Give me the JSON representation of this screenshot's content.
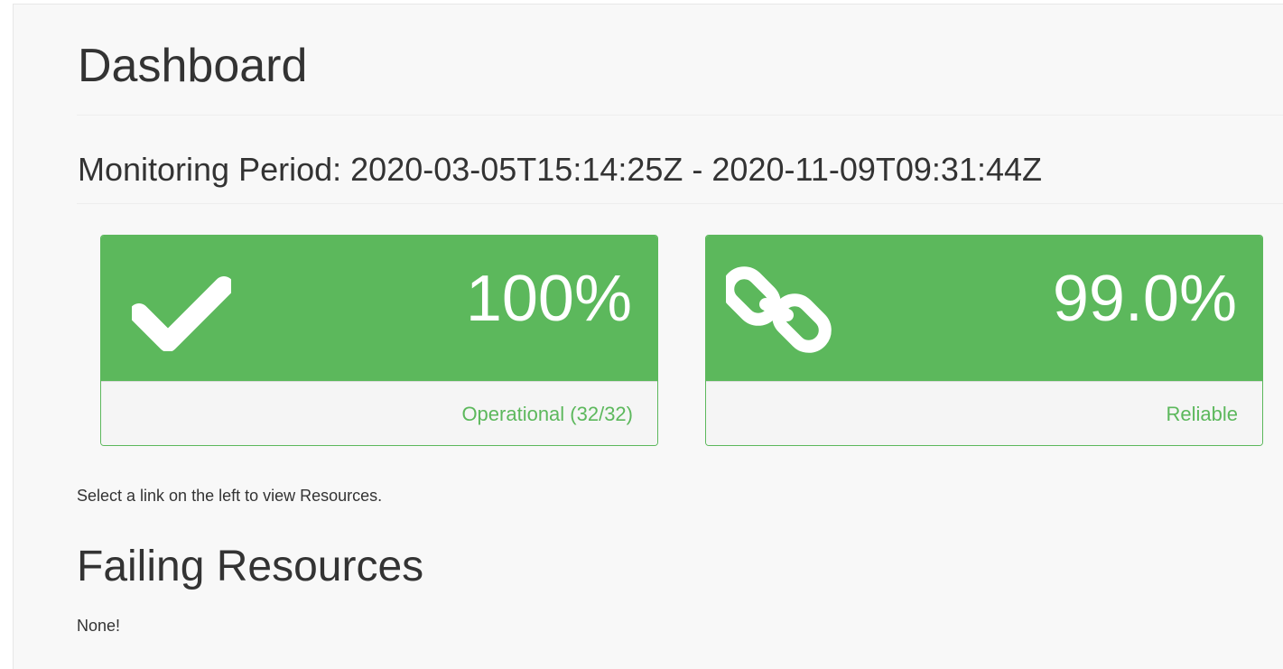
{
  "page": {
    "title": "Dashboard",
    "monitoring_period_label": "Monitoring Period: 2020-03-05T15:14:25Z - 2020-11-09T09:31:44Z"
  },
  "panels": [
    {
      "icon": "check-icon",
      "value": "100%",
      "label": "Operational (32/32)",
      "color": "#5cb85c"
    },
    {
      "icon": "chain-link-icon",
      "value": "99.0%",
      "label": "Reliable",
      "color": "#5cb85c"
    }
  ],
  "info_text": "Select a link on the left to view Resources.",
  "failing_resources": {
    "title": "Failing Resources",
    "empty_text": "None!"
  }
}
